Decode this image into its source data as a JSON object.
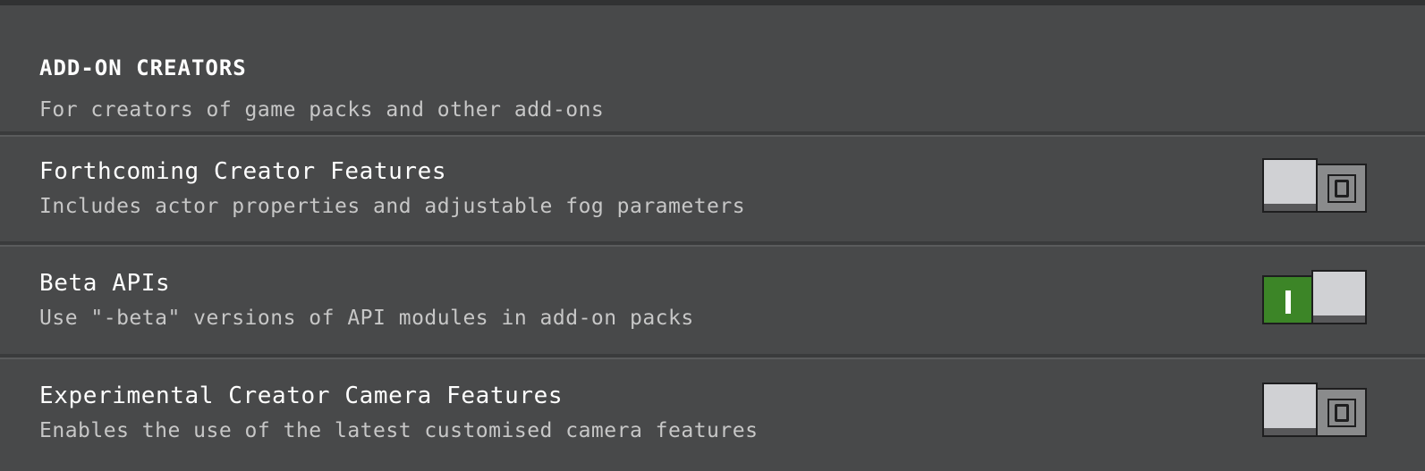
{
  "section": {
    "title": "ADD-ON CREATORS",
    "description": "For creators of game packs and other add-ons"
  },
  "toggles": [
    {
      "title": "Forthcoming Creator Features",
      "description": "Includes actor properties and adjustable fog parameters",
      "enabled": false,
      "state_glyph": "O"
    },
    {
      "title": "Beta APIs",
      "description": "Use \"-beta\" versions of API modules in add-on packs",
      "enabled": true,
      "state_glyph": "I"
    },
    {
      "title": "Experimental Creator Camera Features",
      "description": "Enables the use of the latest customised camera features",
      "enabled": false,
      "state_glyph": "O"
    }
  ],
  "colors": {
    "background": "#48494a",
    "toggle_on": "#3c8527",
    "toggle_off": "#8a8b8c",
    "knob": "#d0d1d4"
  }
}
